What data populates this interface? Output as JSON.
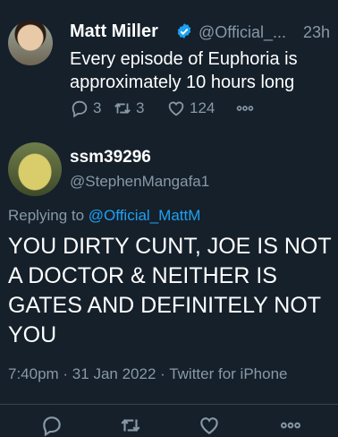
{
  "tweet": {
    "author_name": "Matt Miller",
    "handle": "@Official_...",
    "time": "23h",
    "text": "Every episode of Euphoria is approximately 10 hours long",
    "replies": "3",
    "retweets": "3",
    "likes": "124"
  },
  "reply": {
    "author_name": "ssm39296",
    "handle": "@StephenMangafa1",
    "replying_prefix": "Replying to",
    "replying_to": "@Official_MattM",
    "text": "YOU DIRTY CUNT, JOE IS NOT A DOCTOR & NEITHER IS GATES AND DEFINITELY NOT YOU",
    "meta": "7:40pm · 31 Jan 2022 · Twitter for iPhone"
  },
  "icons": [
    "reply-icon",
    "retweet-icon",
    "like-icon",
    "more-icon",
    "verified-icon"
  ],
  "colors": {
    "background": "#15202b",
    "muted": "#8899a6",
    "accent": "#1da1f2"
  }
}
